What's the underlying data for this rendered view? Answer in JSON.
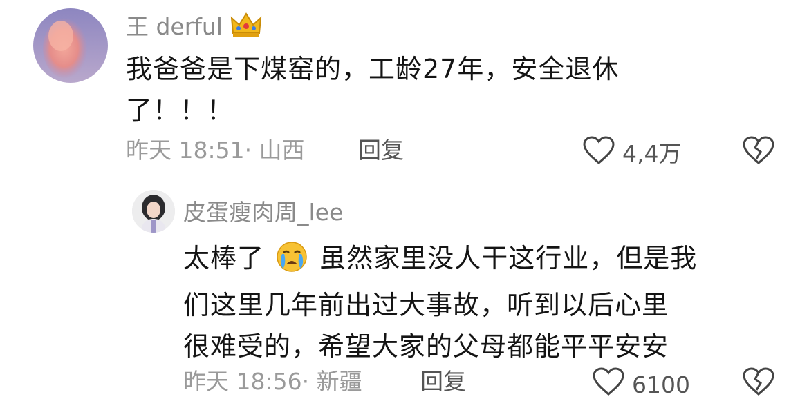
{
  "comments": [
    {
      "username": "王 derful",
      "text_line1": "我爸爸是下煤窑的，工龄27年，安全退休",
      "text_line2": "了！！！",
      "time_location": "昨天 18:51· 山西",
      "reply_label": "回复",
      "like_count": "4,4万"
    },
    {
      "username": "皮蛋瘦肉周_lee",
      "text_line1_before": "太棒了",
      "text_line1_after": "虽然家里没人干这行业，但是我",
      "text_line2": "们这里几年前出过大事故，听到以后心里",
      "text_line3": "很难受的，希望大家的父母都能平平安安",
      "time_location": "昨天 18:56· 新疆",
      "reply_label": "回复",
      "like_count": "6100"
    }
  ],
  "icons": {
    "crown": "crown-icon",
    "heart": "heart-icon",
    "dislike": "broken-heart-icon",
    "crying": "crying-face-emoji"
  }
}
